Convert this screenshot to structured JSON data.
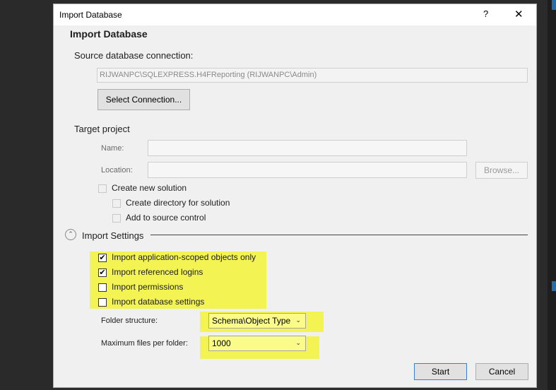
{
  "dialog": {
    "title": "Import Database",
    "help": "?",
    "close": "✕",
    "heading": "Import Database"
  },
  "source": {
    "label": "Source database connection:",
    "connection_value": "RIJWANPC\\SQLEXPRESS.H4FReporting (RIJWANPC\\Admin)",
    "select_button": "Select Connection..."
  },
  "target": {
    "label": "Target project",
    "name_label": "Name:",
    "location_label": "Location:",
    "browse_button": "Browse...",
    "create_new_solution": "Create new solution",
    "create_directory": "Create directory for solution",
    "add_to_source_control": "Add to source control"
  },
  "import_settings": {
    "label": "Import Settings",
    "expander_glyph": "⌃",
    "options": [
      {
        "label": "Import application-scoped objects only",
        "checked": true
      },
      {
        "label": "Import referenced logins",
        "checked": true
      },
      {
        "label": "Import permissions",
        "checked": false
      },
      {
        "label": "Import database settings",
        "checked": false
      }
    ],
    "folder_structure_label": "Folder structure:",
    "folder_structure_value": "Schema\\Object Type",
    "max_files_label": "Maximum files per folder:",
    "max_files_value": "1000"
  },
  "footer": {
    "start_button": "Start",
    "cancel_button": "Cancel"
  },
  "check_glyph": "✔",
  "dropdown_glyph": "⌄",
  "colors": {
    "highlight": "#f3f354",
    "dialog_bg": "#f0f0f0",
    "accent_border": "#3c7fd1"
  }
}
